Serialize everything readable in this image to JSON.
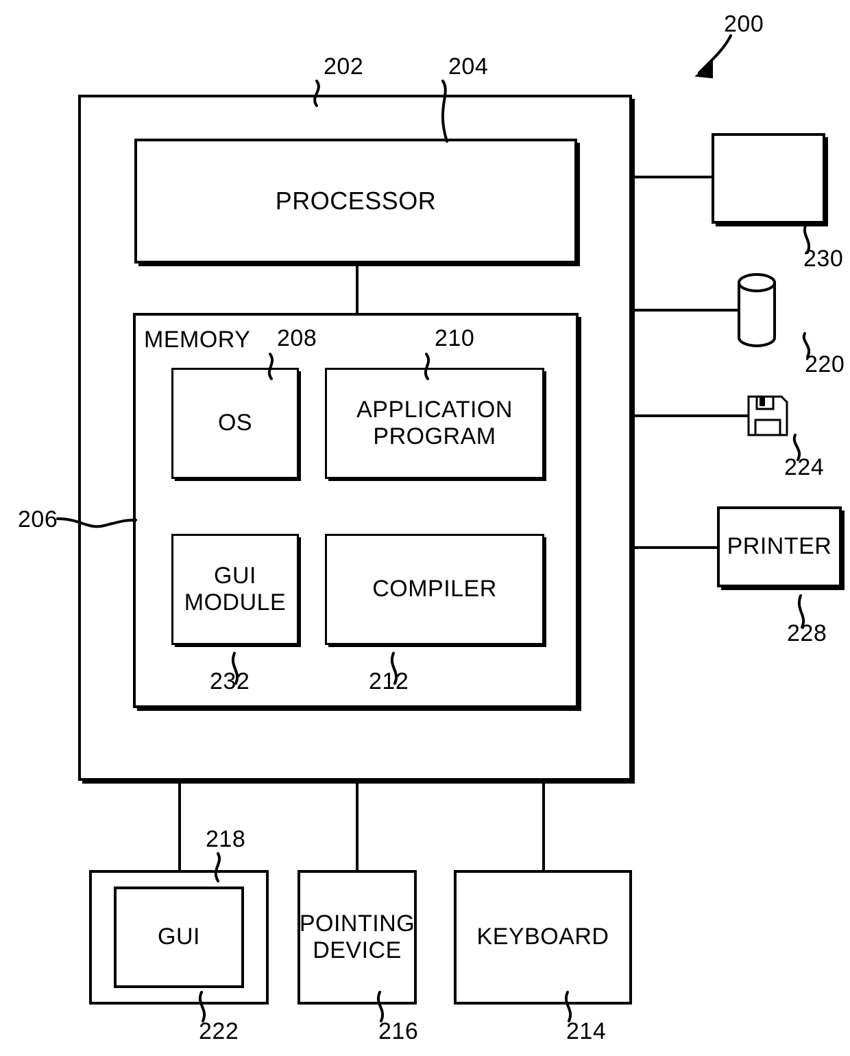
{
  "figure": {
    "title": "Computer system block diagram",
    "overall_ref": "200"
  },
  "blocks": {
    "computer": {
      "label": "",
      "ref": "202"
    },
    "processor": {
      "label": "PROCESSOR",
      "ref": "204"
    },
    "memory": {
      "label": "MEMORY",
      "ref": "206"
    },
    "os": {
      "label": "OS",
      "ref": "208"
    },
    "application_program": {
      "label": "APPLICATION\nPROGRAM",
      "ref": "210"
    },
    "gui_module": {
      "label": "GUI\nMODULE",
      "ref": "232"
    },
    "compiler": {
      "label": "COMPILER",
      "ref": "212"
    },
    "display": {
      "label": "",
      "ref": "230"
    },
    "data_storage": {
      "label": "",
      "ref": "220"
    },
    "floppy_disk": {
      "label": "",
      "ref": "224"
    },
    "printer": {
      "label": "PRINTER",
      "ref": "228"
    },
    "gui_display": {
      "label": "",
      "ref": "222"
    },
    "gui": {
      "label": "GUI",
      "ref": "218"
    },
    "pointing_device": {
      "label": "POINTING\nDEVICE",
      "ref": "216"
    },
    "keyboard": {
      "label": "KEYBOARD",
      "ref": "214"
    }
  }
}
